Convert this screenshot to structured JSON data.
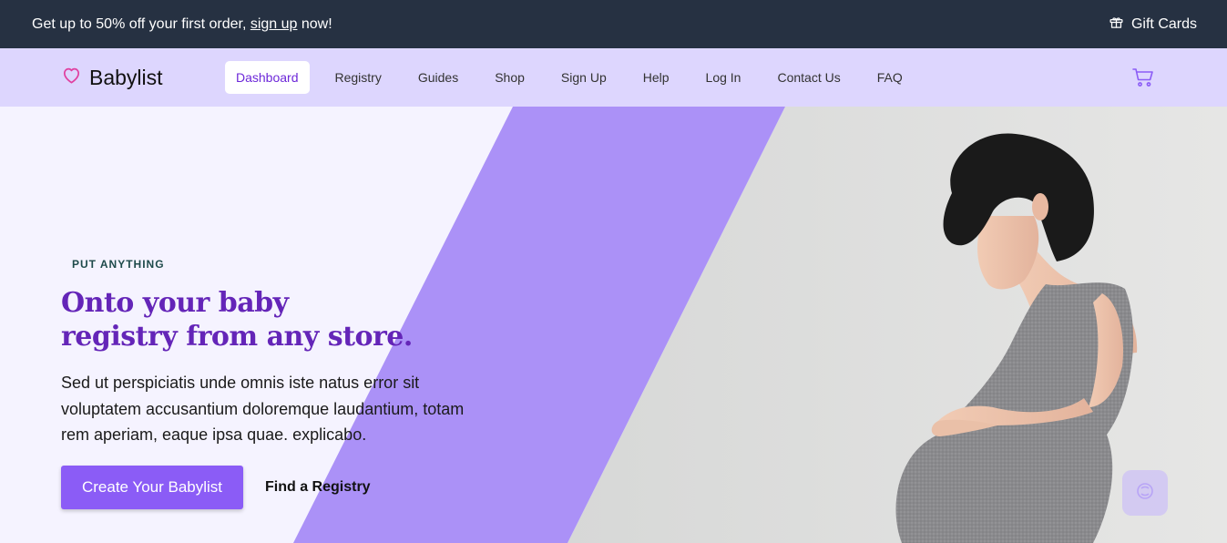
{
  "promo": {
    "text_before": "Get up to 50% off your first order, ",
    "link_text": "sign up",
    "text_after": " now!",
    "gift_label": "Gift Cards",
    "gift_icon": "gift-icon"
  },
  "nav": {
    "brand": "Babylist",
    "brand_icon": "heart-icon",
    "links": [
      {
        "label": "Dashboard",
        "active": true
      },
      {
        "label": "Registry"
      },
      {
        "label": "Guides"
      },
      {
        "label": "Shop"
      },
      {
        "label": "Sign Up"
      },
      {
        "label": "Help"
      },
      {
        "label": "Log In"
      },
      {
        "label": "Contact Us"
      },
      {
        "label": "FAQ"
      }
    ],
    "cart_icon": "cart-icon"
  },
  "hero": {
    "eyebrow": "PUT ANYTHING",
    "title_line1": "Onto your baby",
    "title_line2": "registry from any store.",
    "body": "Sed ut perspiciatis unde omnis iste natus error sit voluptatem accusantium doloremque laudantium, totam rem aperiam, eaque ipsa quae. explicabo.",
    "primary_button": "Create Your Babylist",
    "secondary_link": "Find a Registry",
    "image_subject": "pregnant woman in grey tank top",
    "chat_icon": "chat-widget-icon"
  },
  "colors": {
    "promo_bg": "#263142",
    "nav_bg": "#ddd6fe",
    "hero_bg": "#f5f3ff",
    "diagonal_band": "#ab91f7",
    "title": "#6425b8",
    "primary_button": "#8b5cf6"
  }
}
